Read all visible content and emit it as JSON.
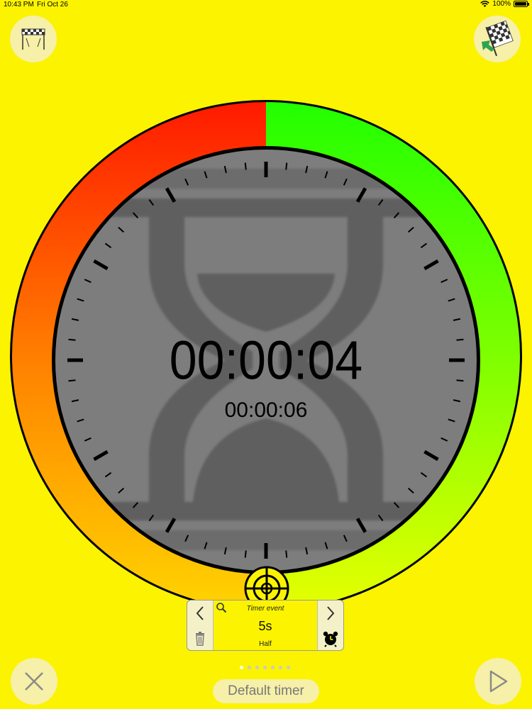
{
  "status_bar": {
    "time": "10:43 PM",
    "date": "Fri Oct 26",
    "battery": "100%"
  },
  "icons": {
    "top_left": "finish-line-flag-icon",
    "top_right": "checkered-flag-icon",
    "crosshair": "crosshair-target-icon",
    "close": "close-icon",
    "play": "play-icon",
    "prev": "chevron-left-icon",
    "next": "chevron-right-icon",
    "search": "search-icon",
    "trash": "trash-icon",
    "alarm": "alarm-clock-icon",
    "background": "hourglass-icon"
  },
  "timer": {
    "main": "00:00:04",
    "secondary": "00:00:06"
  },
  "timer_event": {
    "title": "Timer event",
    "value": "5s",
    "subtitle": "Half"
  },
  "pager": {
    "count": 7,
    "active_index": 0
  },
  "footer": {
    "timer_name": "Default timer"
  },
  "colors": {
    "background": "#fbf300",
    "ring_red": "#ff1a00",
    "ring_orange": "#ff9a00",
    "ring_green": "#33ff00",
    "ring_lime": "#ccff00",
    "dial": "#7d7d7d"
  }
}
